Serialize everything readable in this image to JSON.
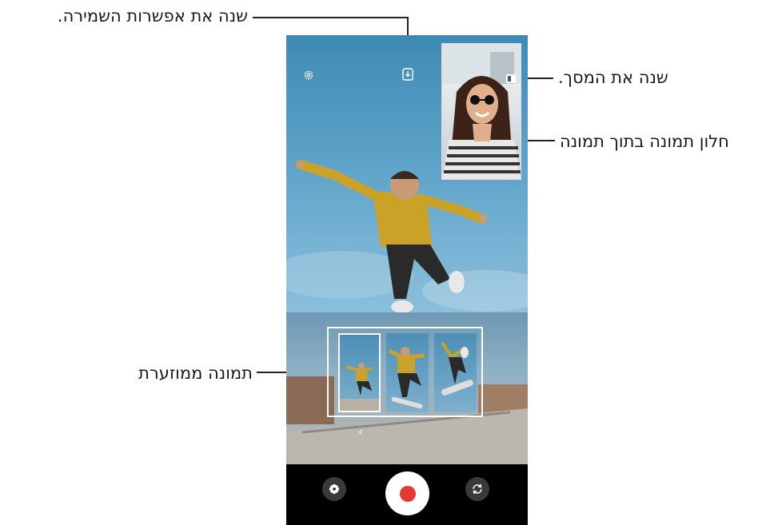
{
  "callouts": {
    "save_option": "שנה את אפשרות השמירה.",
    "change_screen": "שנה את המסך.",
    "pip_window": "חלון תמונה בתוך תמונה",
    "thumbnail": "תמונה ממוזערת"
  },
  "camera": {
    "top_icons": [
      "gear-icon",
      "download-icon",
      "switch-screen-icon"
    ],
    "bottom_controls": [
      "effects-icon",
      "record-button",
      "flip-camera-icon"
    ],
    "back_arrow": "‹",
    "colors": {
      "record": "#e53935",
      "sky": "#5da2c8",
      "control_bar": "#000000"
    }
  }
}
